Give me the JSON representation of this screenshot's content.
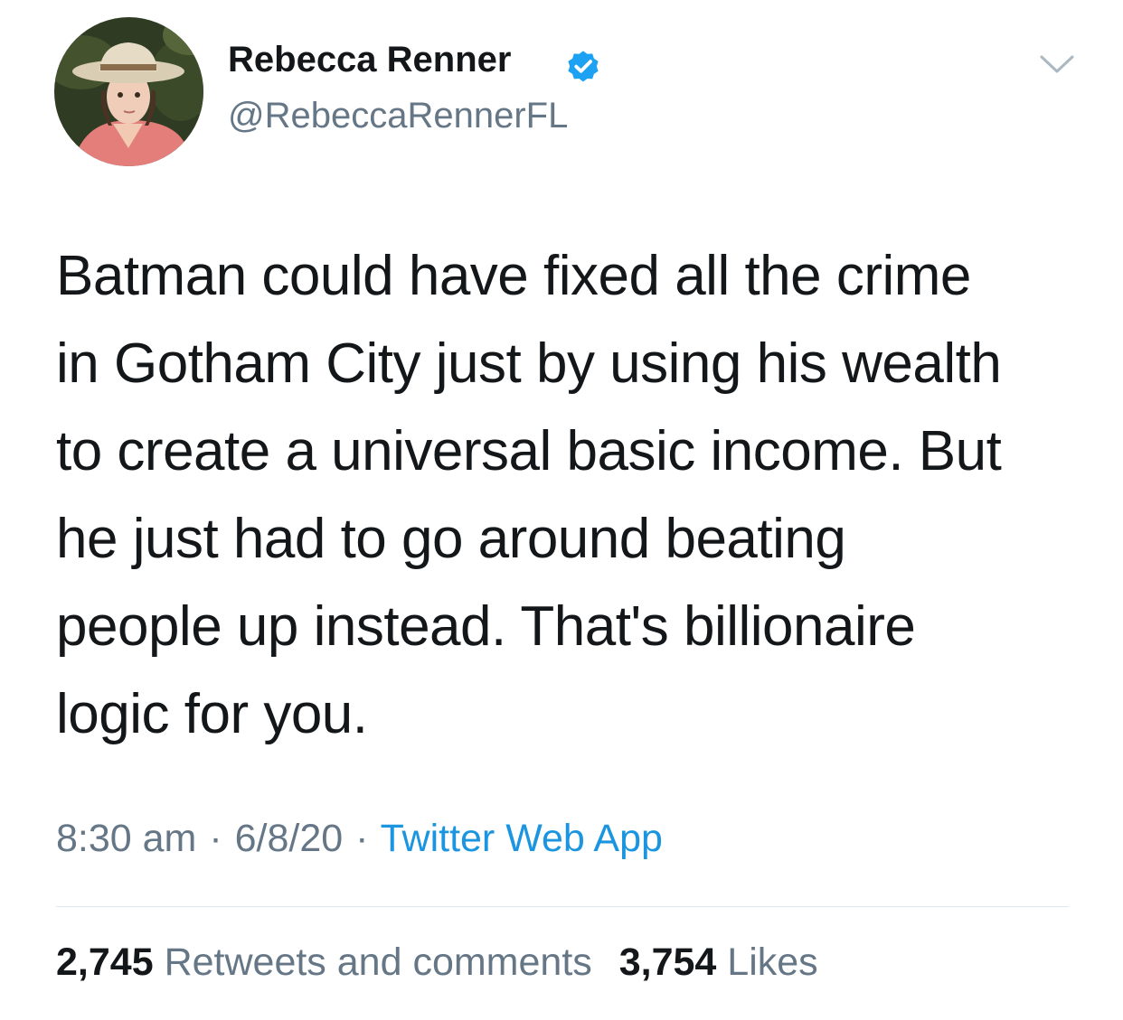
{
  "author": {
    "display_name": "Rebecca Renner",
    "handle": "@RebeccaRennerFL",
    "verified": true
  },
  "tweet": {
    "text": "Batman could have fixed all the crime\nin Gotham City just by using his wealth\nto create a universal basic income. But\nhe just had to go around beating\npeople up instead. That's billionaire\nlogic for you.",
    "time": "8:30 am",
    "date": "6/8/20",
    "separator": "·",
    "source": "Twitter Web App"
  },
  "stats": {
    "retweets_count": "2,745",
    "retweets_label": "Retweets and comments",
    "likes_count": "3,754",
    "likes_label": "Likes"
  },
  "colors": {
    "text": "#14171a",
    "secondary": "#657786",
    "link": "#1b95e0",
    "verified": "#1da1f2",
    "divider": "#e1e8ed"
  },
  "icons": {
    "verified": "verified-badge-icon",
    "menu": "chevron-down-icon"
  }
}
